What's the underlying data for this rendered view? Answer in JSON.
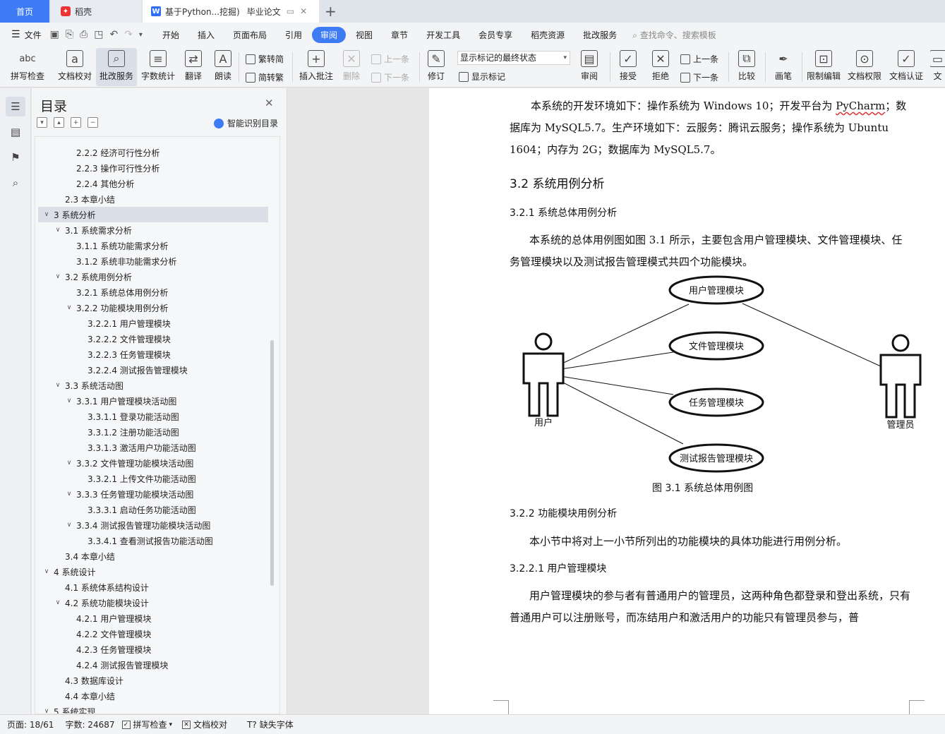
{
  "tabs": {
    "home": "首页",
    "daoke": "稻壳",
    "doc_a": "基于Python...挖掘)",
    "doc_b": "毕业论文"
  },
  "menu": {
    "file": "文件",
    "items": [
      "开始",
      "插入",
      "页面布局",
      "引用",
      "审阅",
      "视图",
      "章节",
      "开发工具",
      "会员专享",
      "稻壳资源",
      "批改服务"
    ],
    "search": "查找命令、搜索模板"
  },
  "ribbon": {
    "spellcheck": "拼写检查",
    "proofread": "文档校对",
    "correction": "批改服务",
    "wordcount": "字数统计",
    "translate": "翻译",
    "read_aloud": "朗读",
    "trad_simp": "繁转简",
    "simp_trad": "简转繁",
    "insert_comment": "插入批注",
    "delete": "删除",
    "prev": "上一条",
    "next": "下一条",
    "revise": "修订",
    "markup_state": "显示标记的最终状态",
    "show_markup": "显示标记",
    "review": "审阅",
    "accept": "接受",
    "reject": "拒绝",
    "prev2": "上一条",
    "next2": "下一条",
    "compare": "比较",
    "pen": "画笔",
    "restrict_edit": "限制编辑",
    "doc_permission": "文档权限",
    "doc_cert": "文档认证",
    "more": "文"
  },
  "toc": {
    "title": "目录",
    "ai_label": "智能识别目录",
    "items": [
      {
        "label": "2.2.2  经济可行性分析",
        "level": 3,
        "toggle": ""
      },
      {
        "label": "2.2.3  操作可行性分析",
        "level": 3,
        "toggle": ""
      },
      {
        "label": "2.2.4  其他分析",
        "level": 3,
        "toggle": ""
      },
      {
        "label": "2.3  本章小结",
        "level": 2,
        "toggle": ""
      },
      {
        "label": "3  系统分析",
        "level": 1,
        "toggle": "v"
      },
      {
        "label": "3.1  系统需求分析",
        "level": 2,
        "toggle": "v"
      },
      {
        "label": "3.1.1  系统功能需求分析",
        "level": 3,
        "toggle": ""
      },
      {
        "label": "3.1.2  系统非功能需求分析",
        "level": 3,
        "toggle": ""
      },
      {
        "label": "3.2 系统用例分析",
        "level": 2,
        "toggle": "v"
      },
      {
        "label": "3.2.1  系统总体用例分析",
        "level": 3,
        "toggle": ""
      },
      {
        "label": "3.2.2  功能模块用例分析",
        "level": 3,
        "toggle": "v"
      },
      {
        "label": "3.2.2.1  用户管理模块",
        "level": 4,
        "toggle": ""
      },
      {
        "label": "3.2.2.2  文件管理模块",
        "level": 4,
        "toggle": ""
      },
      {
        "label": "3.2.2.3  任务管理模块",
        "level": 4,
        "toggle": ""
      },
      {
        "label": "3.2.2.4  测试报告管理模块",
        "level": 4,
        "toggle": ""
      },
      {
        "label": "3.3  系统活动图",
        "level": 2,
        "toggle": "v"
      },
      {
        "label": "3.3.1  用户管理模块活动图",
        "level": 3,
        "toggle": "v"
      },
      {
        "label": "3.3.1.1  登录功能活动图",
        "level": 4,
        "toggle": ""
      },
      {
        "label": "3.3.1.2  注册功能活动图",
        "level": 4,
        "toggle": ""
      },
      {
        "label": "3.3.1.3  激活用户功能活动图",
        "level": 4,
        "toggle": ""
      },
      {
        "label": "3.3.2  文件管理功能模块活动图",
        "level": 3,
        "toggle": "v"
      },
      {
        "label": "3.3.2.1  上传文件功能活动图",
        "level": 4,
        "toggle": ""
      },
      {
        "label": "3.3.3  任务管理功能模块活动图",
        "level": 3,
        "toggle": "v"
      },
      {
        "label": "3.3.3.1  启动任务功能活动图",
        "level": 4,
        "toggle": ""
      },
      {
        "label": "3.3.4  测试报告管理功能模块活动图",
        "level": 3,
        "toggle": "v"
      },
      {
        "label": "3.3.4.1  查看测试报告功能活动图",
        "level": 4,
        "toggle": ""
      },
      {
        "label": "3.4  本章小结",
        "level": 2,
        "toggle": ""
      },
      {
        "label": "4  系统设计",
        "level": 1,
        "toggle": "v"
      },
      {
        "label": "4.1  系统体系结构设计",
        "level": 2,
        "toggle": ""
      },
      {
        "label": "4.2  系统功能模块设计",
        "level": 2,
        "toggle": "v"
      },
      {
        "label": "4.2.1  用户管理模块",
        "level": 3,
        "toggle": ""
      },
      {
        "label": "4.2.2  文件管理模块",
        "level": 3,
        "toggle": ""
      },
      {
        "label": "4.2.3  任务管理模块",
        "level": 3,
        "toggle": ""
      },
      {
        "label": "4.2.4  测试报告管理模块",
        "level": 3,
        "toggle": ""
      },
      {
        "label": "4.3  数据库设计",
        "level": 2,
        "toggle": ""
      },
      {
        "label": "4.4  本章小结",
        "level": 2,
        "toggle": ""
      },
      {
        "label": "5  系统实现",
        "level": 1,
        "toggle": "v"
      }
    ],
    "selected_index": 4
  },
  "doc": {
    "p1a": "本系统的开发环境如下：操作系统为 Windows 10；开发平台为 ",
    "p1_pycharm": "PyCharm",
    "p1b": "；数据库为 MySQL5.7。生产环境如下：云服务：腾讯云服务；操作系统为 Ubuntu 1604；内存为 2G；数据库为 MySQL5.7。",
    "h_32": "3.2 系统用例分析",
    "h_321": "3.2.1  系统总体用例分析",
    "p2": "本系统的总体用例图如图 3.1 所示，主要包含用户管理模块、文件管理模块、任务管理模块以及测试报告管理模式共四个功能模块。",
    "usecase_user_mgmt": "用户管理模块",
    "usecase_file_mgmt": "文件管理模块",
    "usecase_task_mgmt": "任务管理模块",
    "usecase_report_mgmt": "测试报告管理模块",
    "actor_user": "用户",
    "actor_admin": "管理员",
    "caption": "图 3.1  系统总体用例图",
    "h_322": "3.2.2  功能模块用例分析",
    "p3": "本小节中将对上一小节所列出的功能模块的具体功能进行用例分析。",
    "h_3221": "3.2.2.1  用户管理模块",
    "p4": "用户管理模块的参与者有普通用户的管理员，这两种角色都登录和登出系统，只有普通用户可以注册账号，而冻结用户和激活用户的功能只有管理员参与，普"
  },
  "status": {
    "page": "页面: 18/61",
    "words": "字数: 24687",
    "spell": "拼写检查",
    "proof": "文档校对",
    "font": "缺失字体"
  },
  "colors": {
    "accent": "#3d7cf5"
  }
}
